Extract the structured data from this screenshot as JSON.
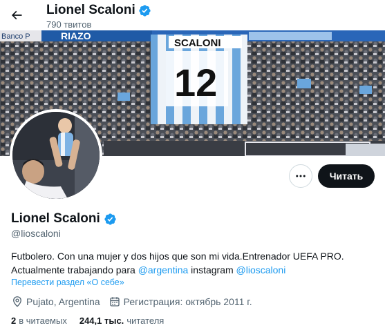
{
  "header": {
    "name": "Lionel Scaloni",
    "tweets_count": "790 твитов",
    "back_icon": "arrow-left-icon"
  },
  "banner": {
    "ad_board_left": "Banco P",
    "ad_board_right": "RIAZO",
    "flag_name": "SCALONI",
    "flag_number": "12"
  },
  "profile": {
    "name": "Lionel Scaloni",
    "handle": "@lioscaloni",
    "verified_color": "#1d9bf0",
    "bio_line1": "Futbolero. Con una mujer y dos hijos que son mi vida.Entrenador UEFA PRO.",
    "bio_line2_prefix": "Actualmente trabajando para ",
    "bio_link1": "@argentina",
    "bio_mid": " instagram ",
    "bio_link2": "@lioscaloni",
    "translate": "Перевести раздел «О себе»",
    "location": "Pujato, Argentina",
    "joined": "Регистрация: октябрь 2011 г.",
    "following_count": "2",
    "following_label": "в читаемых",
    "followers_count": "244,1 тыс.",
    "followers_label": "читателя"
  },
  "actions": {
    "more_icon": "more-horizontal-icon",
    "follow_label": "Читать"
  },
  "colors": {
    "accent": "#1d9bf0",
    "text": "#0f1419",
    "secondary": "#536471",
    "button_dark": "#0f1419"
  }
}
